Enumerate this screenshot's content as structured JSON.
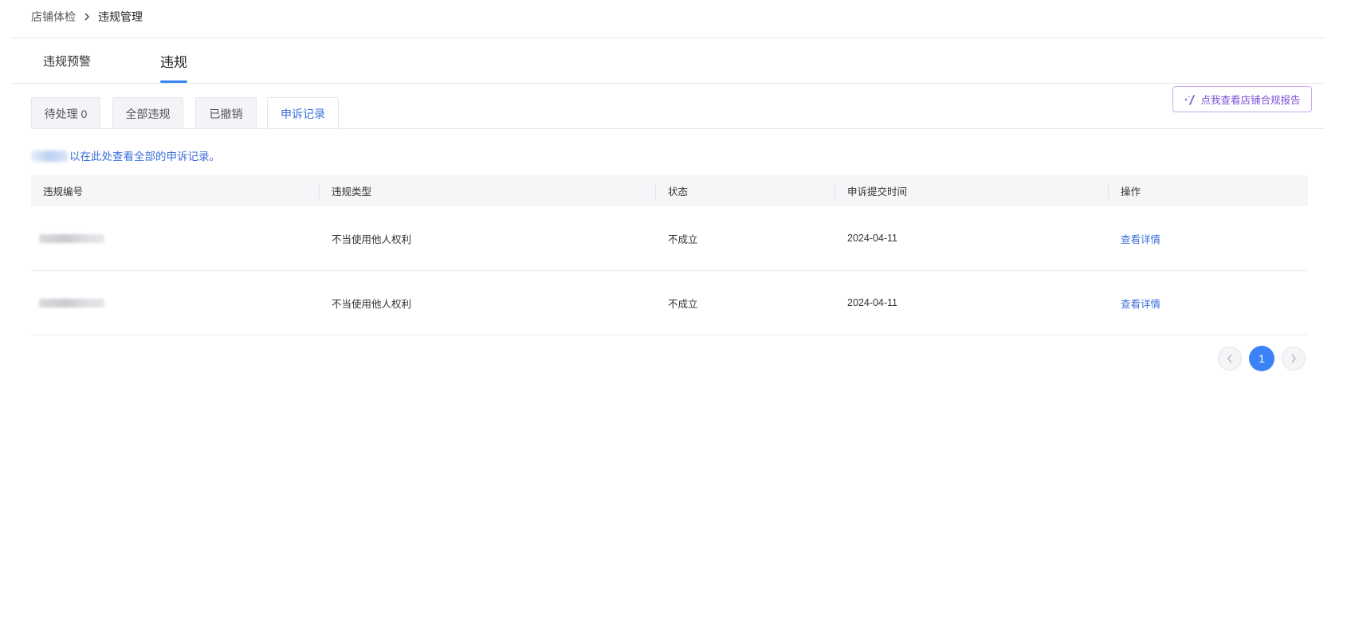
{
  "breadcrumb": {
    "items": [
      "店铺体检",
      "违规管理"
    ],
    "separator_icon": "chevron-right-icon"
  },
  "main_tabs": [
    {
      "label": "违规预警",
      "active": false
    },
    {
      "label": "违规",
      "active": true
    }
  ],
  "sub_tabs": [
    {
      "label": "待处理 0",
      "active": false
    },
    {
      "label": "全部违规",
      "active": false
    },
    {
      "label": "已撤销",
      "active": false
    },
    {
      "label": "申诉记录",
      "active": true
    }
  ],
  "report_button": {
    "label": "点我查看店铺合规报告",
    "icon": "sparkle-wand-icon"
  },
  "notice": {
    "text": "以在此处查看全部的申诉记录。"
  },
  "table": {
    "columns": [
      "违规编号",
      "违规类型",
      "状态",
      "申诉提交时间",
      "操作"
    ],
    "rows": [
      {
        "id": "",
        "type": "不当使用他人权利",
        "status": "不成立",
        "time": "2024-04-11",
        "action": "查看详情"
      },
      {
        "id": "",
        "type": "不当使用他人权利",
        "status": "不成立",
        "time": "2024-04-11",
        "action": "查看详情"
      }
    ]
  },
  "pagination": {
    "current": "1",
    "prev_icon": "chevron-left-icon",
    "next_icon": "chevron-right-icon"
  },
  "colors": {
    "accent": "#3b82f6",
    "link": "#3b6fd8",
    "report_button_text": "#7b4fd6"
  }
}
